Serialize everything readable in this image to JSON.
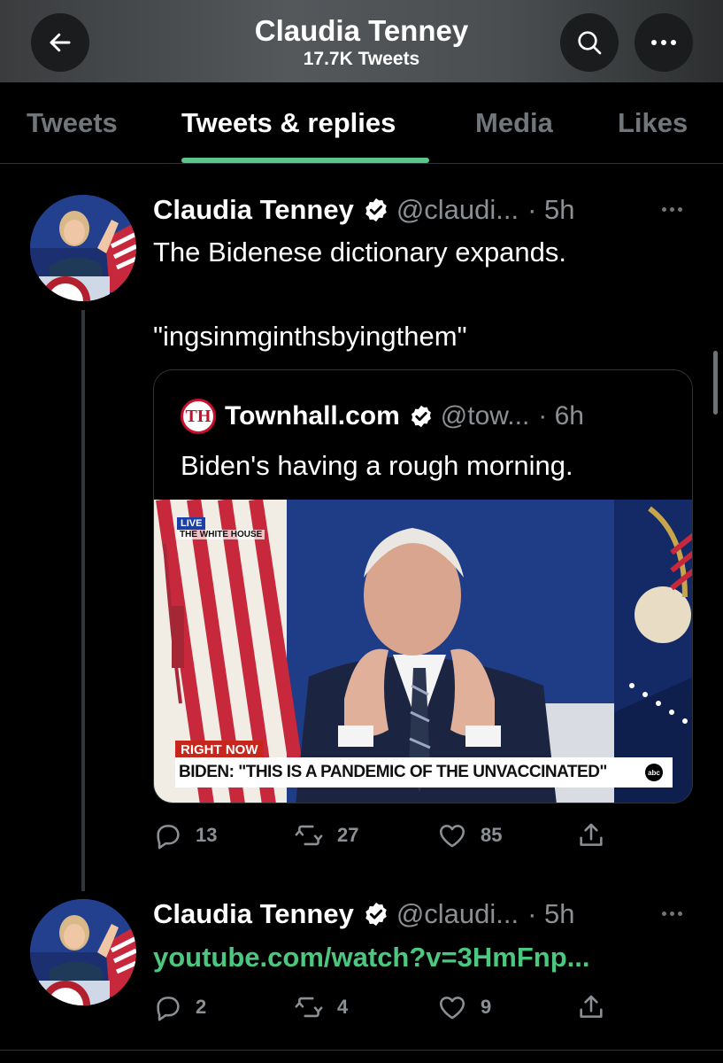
{
  "header": {
    "title": "Claudia Tenney",
    "subtitle": "17.7K Tweets"
  },
  "tabs": [
    {
      "label": "Tweets",
      "active": false
    },
    {
      "label": "Tweets & replies",
      "active": true
    },
    {
      "label": "Media",
      "active": false
    },
    {
      "label": "Likes",
      "active": false
    }
  ],
  "tweets": [
    {
      "name": "Claudia Tenney",
      "handle": "@claudi...",
      "time": "· 5h",
      "text_line1": "The Bidenese dictionary expands.",
      "text_line2": "\"ingsinmginthsbyingthem\"",
      "quote": {
        "logo": "TH",
        "name": "Townhall.com",
        "handle": "@tow...",
        "time": "· 6h",
        "text": "Biden's having a rough morning.",
        "media": {
          "live_label": "LIVE",
          "location": "THE WHITE HOUSE",
          "tag": "RIGHT NOW",
          "caption": "BIDEN: \"THIS IS A PANDEMIC OF THE UNVACCINATED\"",
          "network": "abc"
        }
      },
      "replies": "13",
      "retweets": "27",
      "likes": "85"
    },
    {
      "name": "Claudia Tenney",
      "handle": "@claudi...",
      "time": "· 5h",
      "link": "youtube.com/watch?v=3HmFnp...",
      "replies": "2",
      "retweets": "4",
      "likes": "9"
    }
  ],
  "colors": {
    "accent_green": "#4cc77f",
    "tab_underline": "#5bc88a",
    "muted": "#8b9095",
    "background": "#000000"
  }
}
